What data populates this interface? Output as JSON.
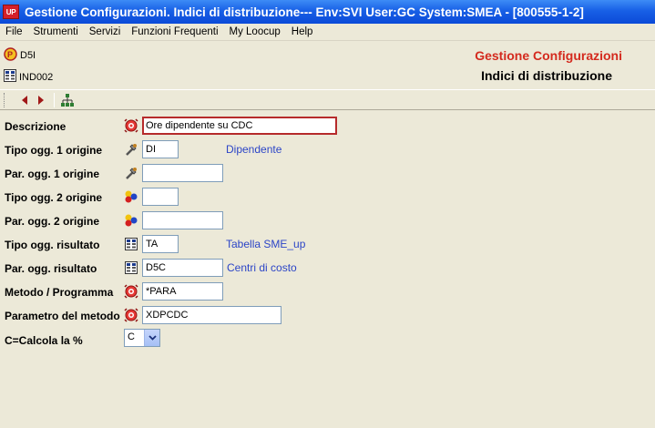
{
  "window": {
    "badge": "UP",
    "title": "Gestione Configurazioni. Indici di distribuzione--- Env:SVI User:GC System:SMEA - [800555-1-2]"
  },
  "menu": [
    "File",
    "Strumenti",
    "Servizi",
    "Funzioni Frequenti",
    "My Loocup",
    "Help"
  ],
  "header": {
    "code1": "D5I",
    "code2": "IND002",
    "title": "Gestione Configurazioni",
    "subtitle": "Indici di distribuzione"
  },
  "toolbar": {
    "prev_icon": "arrow-left-icon",
    "next_icon": "arrow-right-icon",
    "tree_icon": "tree-icon"
  },
  "form": {
    "descrizione": {
      "label": "Descrizione",
      "icon": "alarm-icon",
      "value": "Ore dipendente su CDC"
    },
    "tipo1": {
      "label": "Tipo ogg. 1 origine",
      "icon": "wrench-icon",
      "value": "DI",
      "desc": "Dipendente"
    },
    "par1": {
      "label": "Par. ogg. 1 origine",
      "icon": "wrench-icon",
      "value": ""
    },
    "tipo2": {
      "label": "Tipo ogg. 2 origine",
      "icon": "balls-icon",
      "value": ""
    },
    "par2": {
      "label": "Par. ogg. 2 origine",
      "icon": "balls-icon",
      "value": ""
    },
    "tipor": {
      "label": "Tipo ogg. risultato",
      "icon": "table-icon",
      "value": "TA",
      "desc": "Tabella SME_up"
    },
    "parr": {
      "label": "Par. ogg. risultato",
      "icon": "table-icon",
      "value": "D5C",
      "desc": "Centri di costo"
    },
    "metodo": {
      "label": "Metodo / Programma",
      "icon": "alarm-icon",
      "value": "*PARA"
    },
    "parametro": {
      "label": "Parametro del metodo",
      "icon": "alarm-icon",
      "value": "XDPCDC"
    },
    "calcola": {
      "label": "C=Calcola la %",
      "value": "C"
    }
  },
  "colors": {
    "accent_red": "#d42a1e",
    "link_blue": "#2c45c7",
    "titlebar_blue": "#0b4ad8"
  }
}
